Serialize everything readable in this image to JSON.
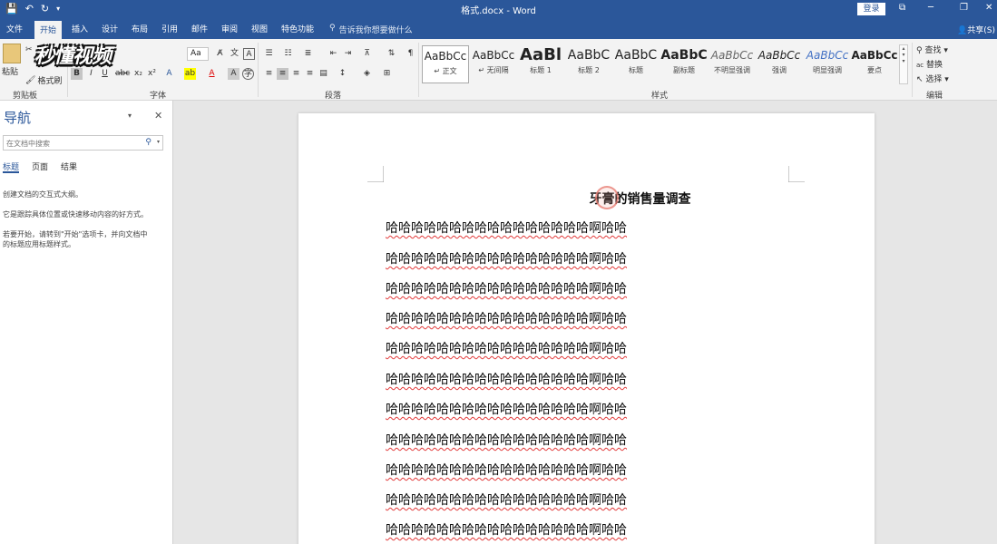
{
  "window": {
    "title": "格式.docx - Word",
    "login_label": "登录",
    "share_label": "共享(S)"
  },
  "tabs": [
    "文件",
    "开始",
    "插入",
    "设计",
    "布局",
    "引用",
    "邮件",
    "审阅",
    "视图",
    "特色功能"
  ],
  "active_tab": "开始",
  "tell_me_placeholder": "告诉我你想要做什么",
  "logo_text": "秒懂视频",
  "ribbon": {
    "clipboard": {
      "paste_label": "粘贴",
      "format_painter_label": "格式刷",
      "group_label": "剪贴板"
    },
    "font": {
      "font_size_label": "Aa",
      "group_label": "字体",
      "bold": "B",
      "italic": "I",
      "underline": "U",
      "strike": "abc",
      "subscript": "x₂",
      "superscript": "x²"
    },
    "paragraph": {
      "group_label": "段落"
    },
    "styles": {
      "group_label": "样式",
      "items": [
        {
          "sample": "AaBbCc",
          "name": "↵ 正文"
        },
        {
          "sample": "AaBbCc",
          "name": "↵ 无间隔"
        },
        {
          "sample": "AaBl",
          "name": "标题 1"
        },
        {
          "sample": "AaBbC",
          "name": "标题 2"
        },
        {
          "sample": "AaBbC",
          "name": "标题"
        },
        {
          "sample": "AaBbC",
          "name": "副标题"
        },
        {
          "sample": "AaBbCc",
          "name": "不明显强调"
        },
        {
          "sample": "AaBbCc",
          "name": "强调"
        },
        {
          "sample": "AaBbCc",
          "name": "明显强调"
        },
        {
          "sample": "AaBbCc",
          "name": "要点"
        }
      ]
    },
    "editing": {
      "find_label": "查找",
      "replace_label": "替换",
      "select_label": "选择",
      "group_label": "编辑"
    }
  },
  "nav_pane": {
    "title": "导航",
    "search_placeholder": "在文档中搜索",
    "tabs": [
      "标题",
      "页面",
      "结果"
    ],
    "active_tab": "标题",
    "help_lines": [
      "创建文档的交互式大纲。",
      "它是跟踪具体位置或快速移动内容的好方式。",
      "若要开始，请转到\"开始\"选项卡，并向文档中",
      "的标题应用标题样式。"
    ]
  },
  "document": {
    "heading": "牙膏的销售量调查",
    "paragraphs": [
      "哈哈哈哈哈哈哈哈哈哈哈哈哈哈哈哈啊哈哈",
      "哈哈哈哈哈哈哈哈哈哈哈哈哈哈哈哈啊哈哈",
      "哈哈哈哈哈哈哈哈哈哈哈哈哈哈哈哈啊哈哈",
      "哈哈哈哈哈哈哈哈哈哈哈哈哈哈哈哈啊哈哈",
      "哈哈哈哈哈哈哈哈哈哈哈哈哈哈哈哈啊哈哈",
      "哈哈哈哈哈哈哈哈哈哈哈哈哈哈哈哈啊哈哈",
      "哈哈哈哈哈哈哈哈哈哈哈哈哈哈哈哈啊哈哈",
      "哈哈哈哈哈哈哈哈哈哈哈哈哈哈哈哈啊哈哈",
      "哈哈哈哈哈哈哈哈哈哈哈哈哈哈哈哈啊哈哈",
      "哈哈哈哈哈哈哈哈哈哈哈哈哈哈哈哈啊哈哈",
      "哈哈哈哈哈哈哈哈哈哈哈哈哈哈哈哈啊哈哈"
    ]
  },
  "colors": {
    "brand": "#2b579a",
    "ribbon_bg": "#f3f3f3",
    "spell_underline": "#e23a3a"
  }
}
